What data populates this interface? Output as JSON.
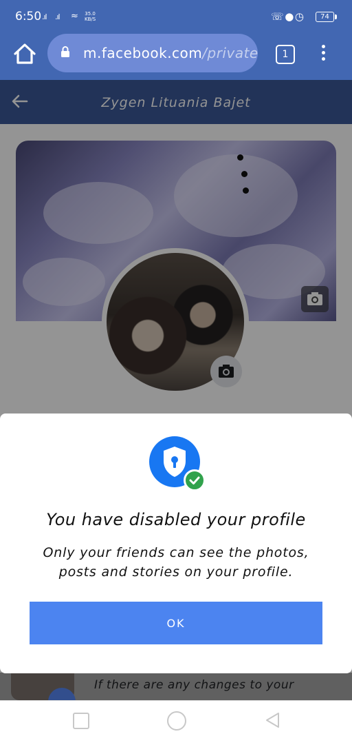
{
  "status_bar": {
    "time": "6:50",
    "signal_1": ".ıl",
    "signal_2": ".ıl",
    "net_speed_value": "35.0",
    "net_speed_unit": "KB/S",
    "battery": "74"
  },
  "browser": {
    "url_host": "m.facebook.com",
    "url_path": "/private",
    "tab_count": "1"
  },
  "page": {
    "title": "Zygen Lituania Bajet"
  },
  "dialog": {
    "title": "You have disabled your profile",
    "body": "Only your friends can see the photos, posts and stories on your profile.",
    "ok_label": "OK"
  },
  "behind": {
    "text": "If there are any changes to your"
  },
  "colors": {
    "brand_blue": "#4267b2",
    "header_blue": "#3b5998",
    "button_blue": "#4c84f0",
    "shield_blue": "#1877f2",
    "check_green": "#31a24c"
  },
  "icons": {
    "home": "home-icon",
    "lock": "lock-icon",
    "tabs": "tabs-icon",
    "menu": "more-vert-icon",
    "back": "back-arrow-icon",
    "camera": "camera-icon",
    "shield": "shield-lock-icon",
    "check": "check-icon",
    "recents": "square-icon",
    "home_nav": "circle-icon",
    "back_nav": "triangle-back-icon"
  }
}
